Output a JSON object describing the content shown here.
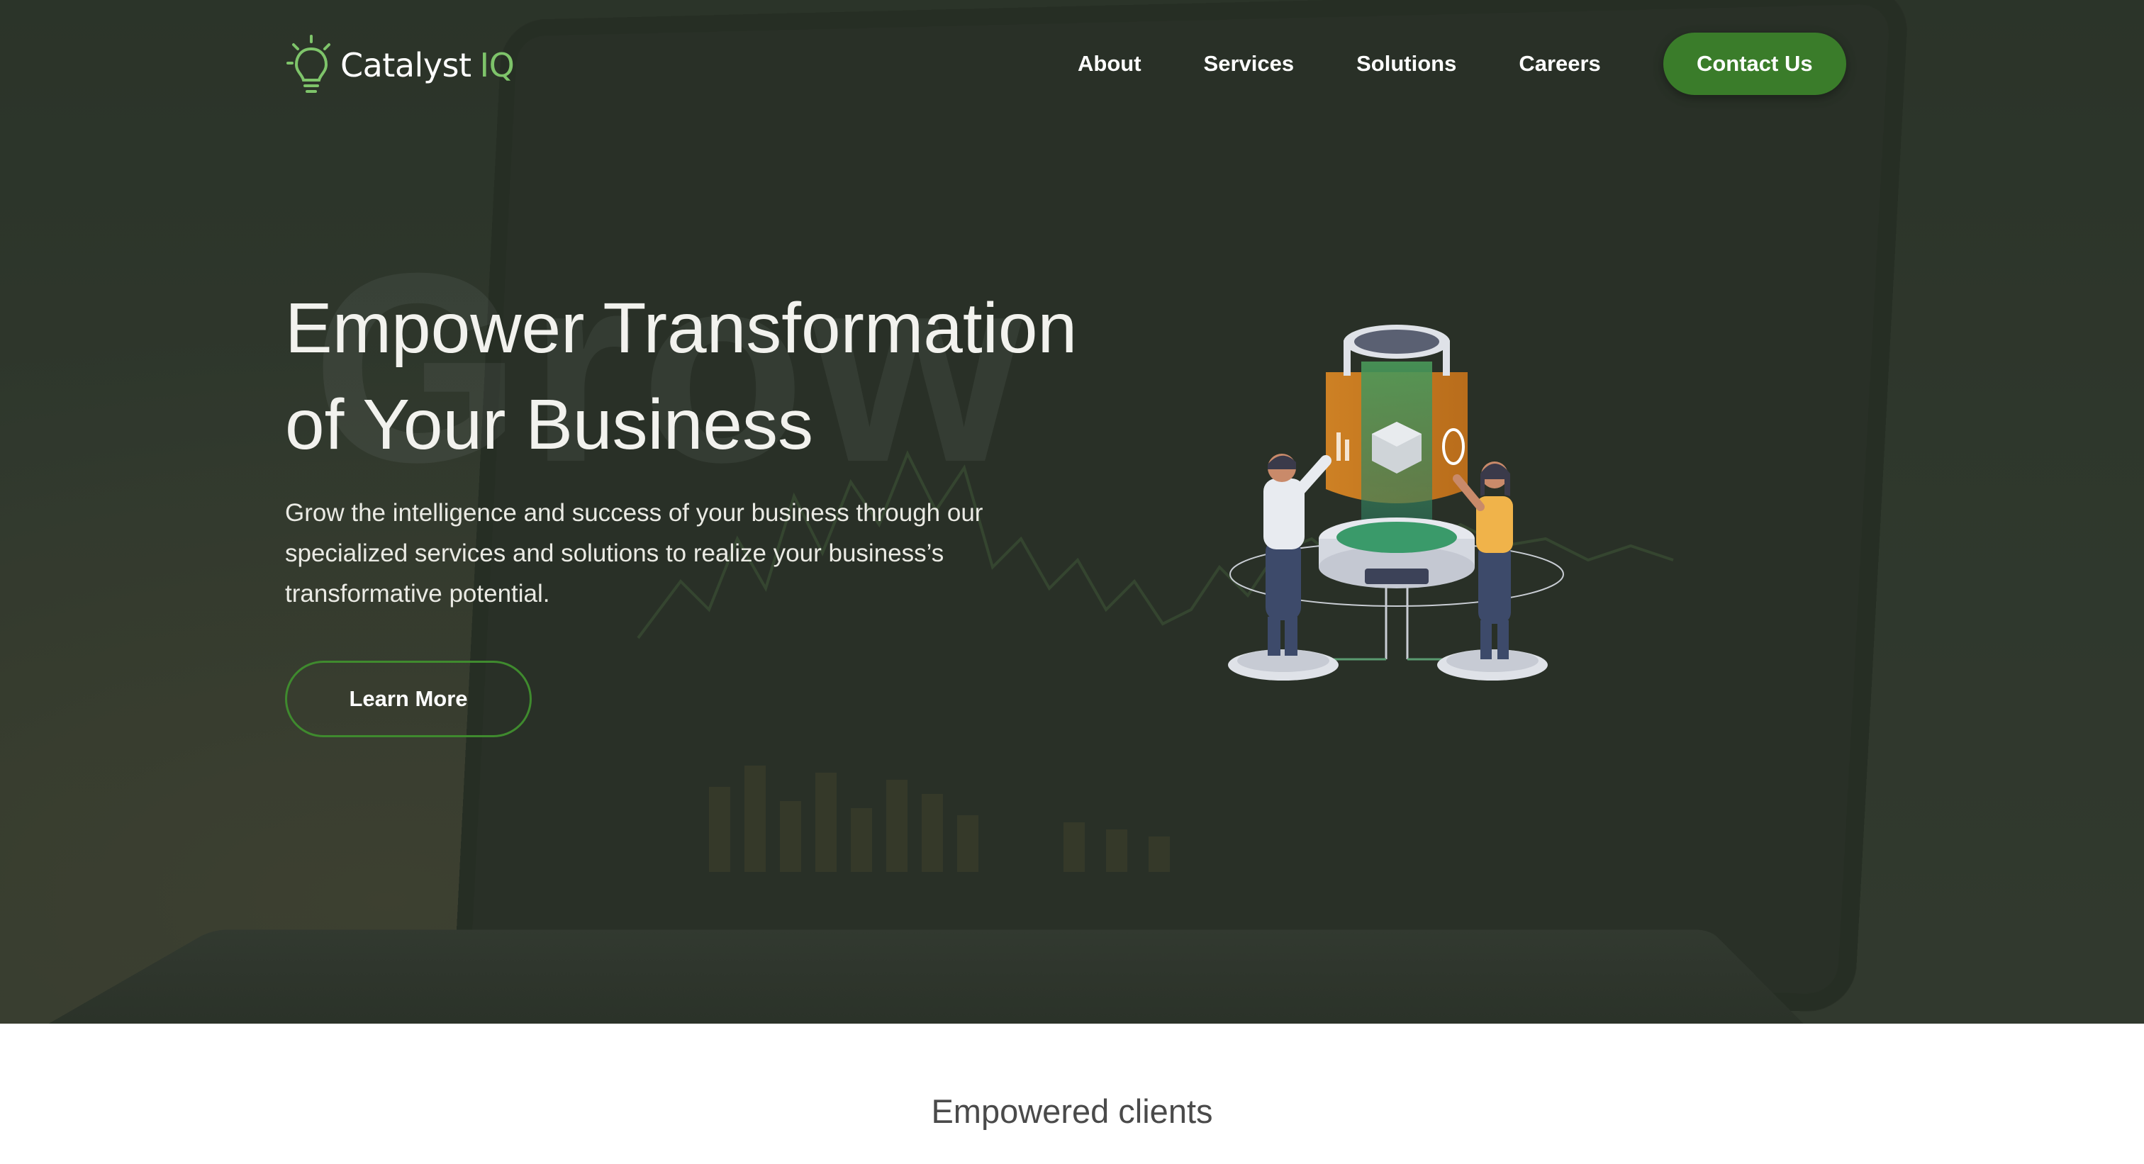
{
  "brand": {
    "name": "Catalyst",
    "accent": "IQ",
    "accent_color": "#7ec46a"
  },
  "nav": {
    "links": [
      "About",
      "Services",
      "Solutions",
      "Careers"
    ],
    "contact_label": "Contact Us",
    "contact_color": "#3a7c2a"
  },
  "hero": {
    "watermark": "Grow",
    "headline_line1": "Empower Transformation",
    "headline_line2": "of Your Business",
    "subtext": "Grow the intelligence and success of your business through our specialized services and solutions to realize your business’s transformative potential.",
    "cta_label": "Learn More",
    "illustration": "data-platform-illustration"
  },
  "clients": {
    "title": "Empowered clients"
  }
}
